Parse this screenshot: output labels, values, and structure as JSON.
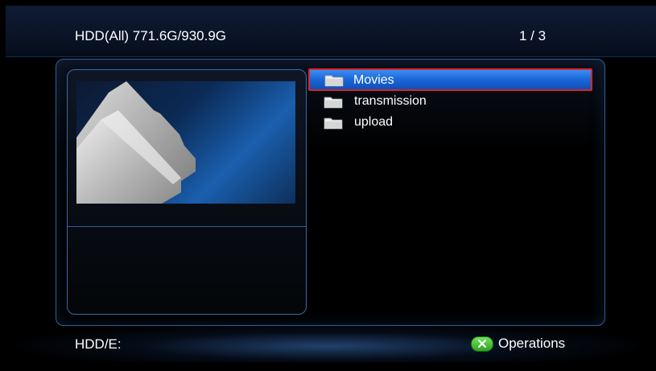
{
  "header": {
    "storage_label": "HDD(All) 771.6G/930.9G",
    "page_indicator": "1 / 3"
  },
  "files": [
    {
      "name": "Movies",
      "icon": "folder-icon",
      "selected": true
    },
    {
      "name": "transmission",
      "icon": "folder-icon",
      "selected": false
    },
    {
      "name": "upload",
      "icon": "folder-icon",
      "selected": false
    }
  ],
  "footer": {
    "path": "HDD/E:",
    "operations_label": "Operations",
    "operations_icon": "green-x-button-icon"
  },
  "colors": {
    "selection": "#1c6ad8",
    "selection_border": "#d8262a",
    "panel_border": "#2f5f9a",
    "op_button": "#2fa21f"
  }
}
